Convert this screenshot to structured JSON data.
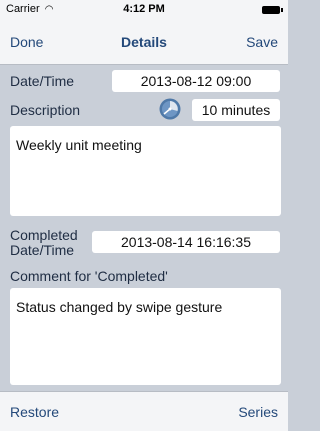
{
  "status_bar": {
    "carrier": "Carrier",
    "time": "4:12 PM"
  },
  "nav": {
    "left_button": "Done",
    "title": "Details",
    "right_button": "Save"
  },
  "form": {
    "datetime_label": "Date/Time",
    "datetime_value": "2013-08-12 09:00",
    "description_label": "Description",
    "duration_value": "10 minutes",
    "description_text": "Weekly unit meeting",
    "completed_label_line1": "Completed",
    "completed_label_line2": "Date/Time",
    "completed_value": "2013-08-14 16:16:35",
    "comment_label": "Comment for 'Completed'",
    "comment_text": "Status changed by swipe gesture"
  },
  "toolbar": {
    "left_button": "Restore",
    "right_button": "Series"
  },
  "icons": {
    "duration": "timer-icon",
    "wifi": "wifi-icon",
    "battery": "battery-icon"
  },
  "colors": {
    "accent": "#24497a",
    "background": "#c9cfd8",
    "bars": "#f4f5f7"
  }
}
